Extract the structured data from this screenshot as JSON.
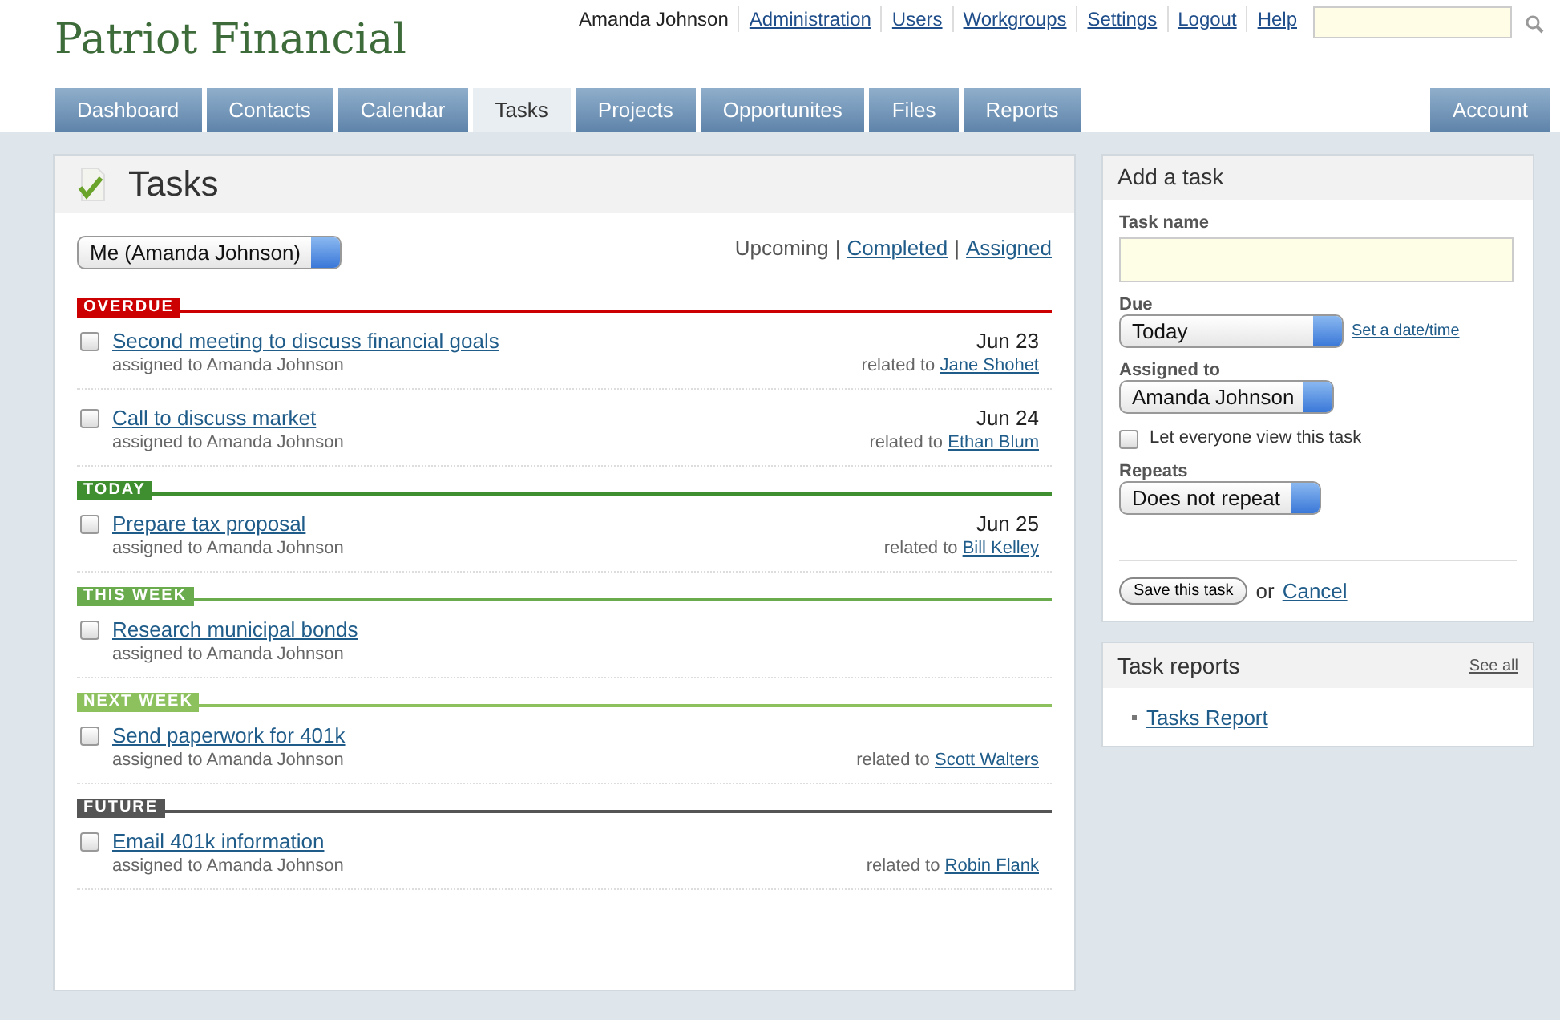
{
  "brand": "Patriot Financial",
  "user_nav": {
    "user": "Amanda Johnson",
    "links": [
      "Administration",
      "Users",
      "Workgroups",
      "Settings",
      "Logout",
      "Help"
    ]
  },
  "tabs": [
    {
      "label": "Dashboard",
      "selected": false
    },
    {
      "label": "Contacts",
      "selected": false
    },
    {
      "label": "Calendar",
      "selected": false
    },
    {
      "label": "Tasks",
      "selected": true
    },
    {
      "label": "Projects",
      "selected": false
    },
    {
      "label": "Opportunites",
      "selected": false
    },
    {
      "label": "Files",
      "selected": false
    },
    {
      "label": "Reports",
      "selected": false
    }
  ],
  "account_tab": {
    "label": "Account",
    "selected": false
  },
  "tasks_panel": {
    "title": "Tasks",
    "owner": "Me (Amanda Johnson)",
    "filters": [
      {
        "label": "Upcoming",
        "selected": true
      },
      {
        "separator": "|",
        "label": "Completed",
        "selected": false
      },
      {
        "separator": "|",
        "label": "Assigned",
        "selected": false
      }
    ],
    "groups": [
      {
        "label": "OVERDUE",
        "color": "#cc0000",
        "tasks": [
          {
            "title": "Second meeting to discuss financial goals",
            "checked": false,
            "assignee": "assigned to Amanda Johnson",
            "due": "Jun 23",
            "related_label": "related to",
            "related_name": "Jane Shohet"
          },
          {
            "title": "Call to discuss market",
            "checked": false,
            "assignee": "assigned to Amanda Johnson",
            "due": "Jun 24",
            "related_label": "related to",
            "related_name": "Ethan Blum"
          }
        ]
      },
      {
        "label": "TODAY",
        "color": "#3f8f30",
        "tasks": [
          {
            "title": "Prepare tax proposal",
            "checked": false,
            "assignee": "assigned to Amanda Johnson",
            "due": "Jun 25",
            "related_label": "related to",
            "related_name": "Bill Kelley"
          }
        ]
      },
      {
        "label": "THIS WEEK",
        "color": "#6aab4e",
        "tasks": [
          {
            "title": "Research municipal bonds",
            "checked": false,
            "assignee": "assigned to Amanda Johnson"
          }
        ]
      },
      {
        "label": "NEXT WEEK",
        "color": "#8cc15e",
        "tasks": [
          {
            "title": "Send paperwork for 401k",
            "checked": false,
            "assignee": "assigned to Amanda Johnson",
            "related_label": "related to",
            "related_name": "Scott Walters"
          }
        ]
      },
      {
        "label": "FUTURE",
        "color": "#555555",
        "tasks": [
          {
            "title": "Email 401k information",
            "checked": false,
            "assignee": "assigned to Amanda Johnson",
            "related_label": "related to",
            "related_name": "Robin Flank"
          }
        ]
      }
    ]
  },
  "add_task": {
    "title": "Add a task",
    "task_name_label": "Task name",
    "due_label": "Due",
    "due_value": "Today",
    "set_date_link": "Set a date/time",
    "assigned_label": "Assigned to",
    "assigned_value": "Amanda Johnson",
    "share": {
      "label": "Let everyone view this task",
      "checked": false
    },
    "repeats_label": "Repeats",
    "repeats_value": "Does not repeat",
    "save_button": "Save this task",
    "or_text": "or",
    "cancel_link": "Cancel"
  },
  "task_reports": {
    "title": "Task reports",
    "see_all": "See all",
    "items": [
      "Tasks Report"
    ]
  }
}
